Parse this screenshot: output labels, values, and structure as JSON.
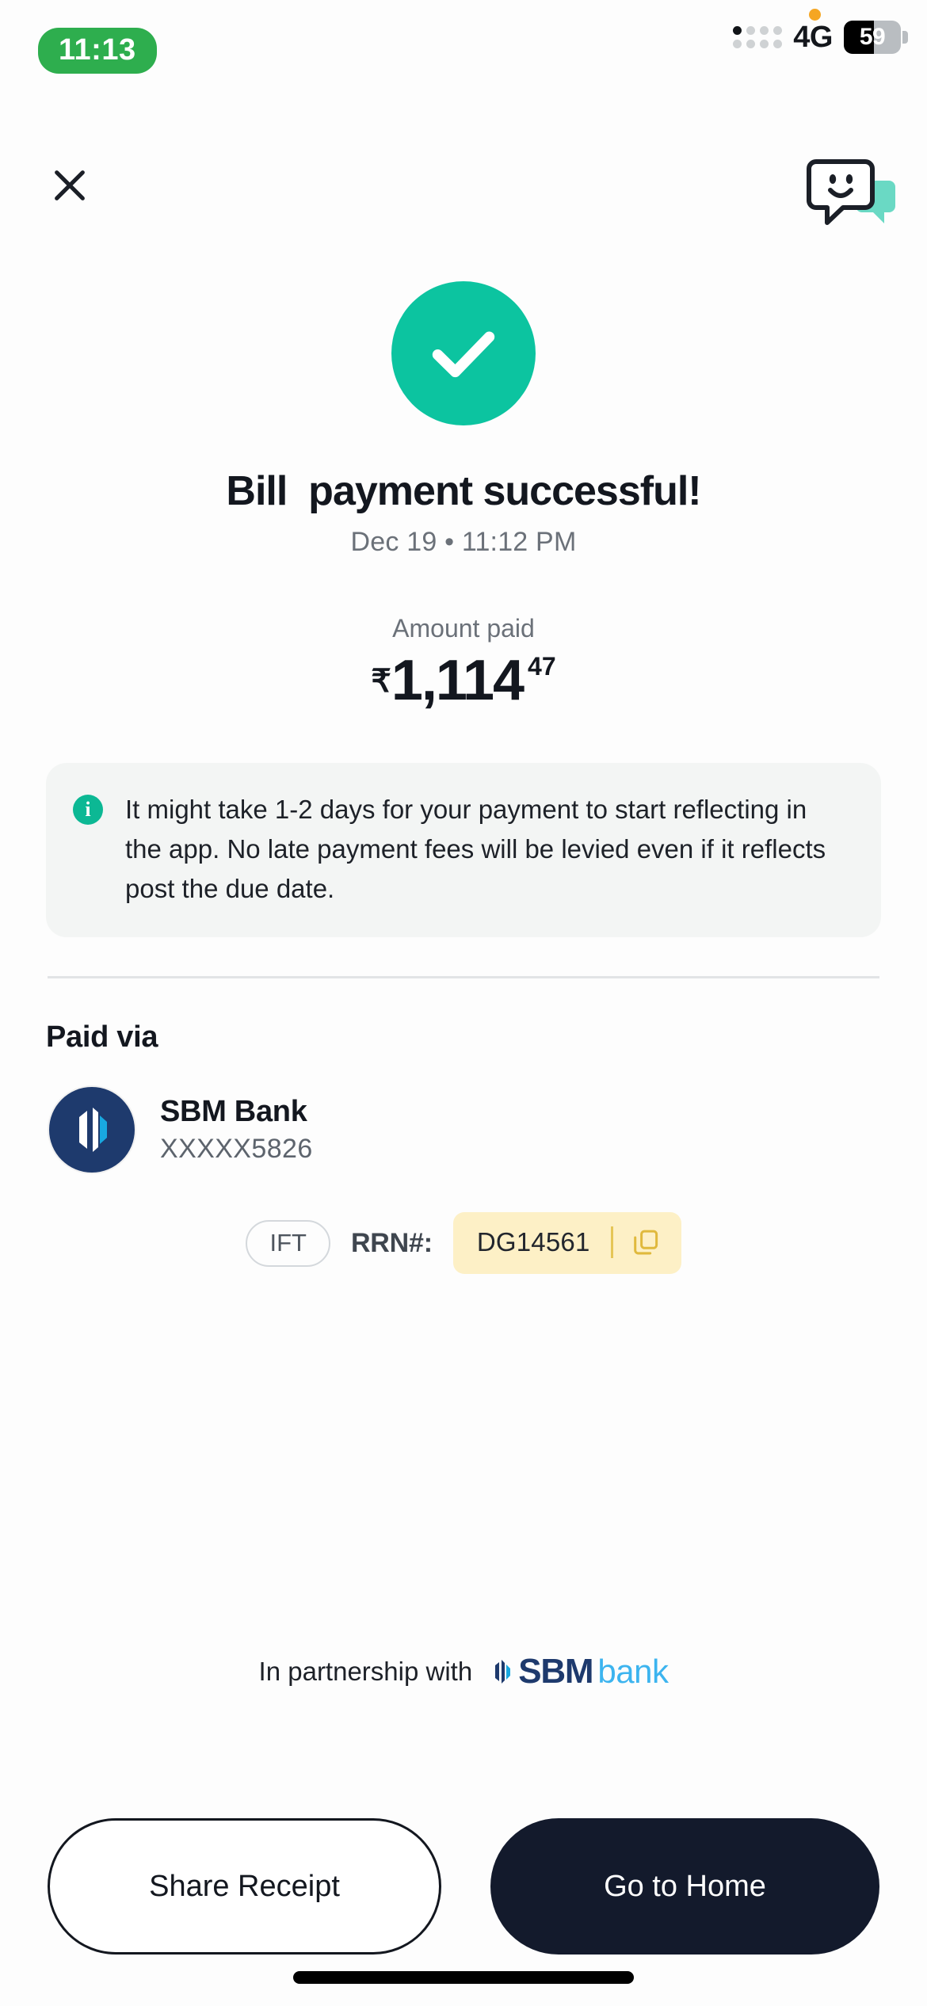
{
  "status_bar": {
    "time": "11:13",
    "network": "4G",
    "battery_percent": "59",
    "time_pill_color": "#2eae4e",
    "notification_dot_color": "#f5a623",
    "signal_icon": "signal-dots-icon",
    "battery_icon": "battery-icon"
  },
  "nav": {
    "close_icon": "close-icon",
    "chat_icon": "chat-support-smiley-icon"
  },
  "success": {
    "check_icon": "success-check-icon",
    "accent_color": "#0cc4a0",
    "title": "Bill  payment successful!",
    "datetime": "Dec 19  •  11:12 PM",
    "date": "Dec 19",
    "time": "11:12 PM",
    "amount_label": "Amount paid",
    "currency_symbol": "₹",
    "amount_major": "1,114",
    "amount_minor": "47"
  },
  "info_note": {
    "icon": "info-icon",
    "icon_color": "#0cb894",
    "text": "It might take 1-2 days for your payment to start reflecting in the app. No late payment fees will be levied even if it reflects post the due date."
  },
  "paid_via": {
    "section_label": "Paid via",
    "bank_logo_icon": "sbm-bank-logo-icon",
    "bank_name": "SBM Bank",
    "account_masked": "XXXXX5826",
    "logo_bg_color": "#1e3a6d"
  },
  "transaction": {
    "mode_badge": "IFT",
    "rrn_label": "RRN#:",
    "rrn_value": "DG14561",
    "copy_icon": "copy-icon",
    "chip_bg_color": "#fdf0c6"
  },
  "partnership": {
    "text": "In partnership with",
    "logo_mark_icon": "sbm-mark-icon",
    "brand_primary": "SBM",
    "brand_secondary": "bank",
    "brand_primary_color": "#1e3a6d",
    "brand_secondary_color": "#3cb4ef"
  },
  "actions": {
    "share_receipt": "Share Receipt",
    "go_to_home": "Go to Home",
    "primary_bg_color": "#131a2c"
  }
}
